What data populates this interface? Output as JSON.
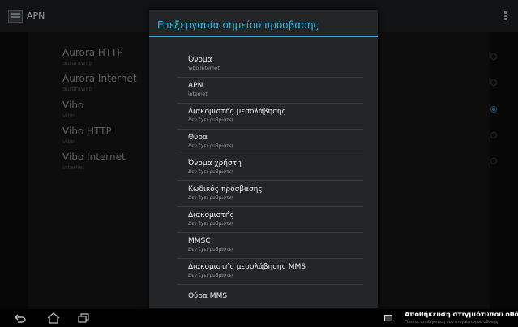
{
  "action_bar": {
    "title": "APN"
  },
  "apn_list": [
    {
      "name": "Aurora HTTP",
      "sub": "aurorawap",
      "selected": false
    },
    {
      "name": "Aurora Internet",
      "sub": "auroraweb",
      "selected": false
    },
    {
      "name": "Vibo",
      "sub": "vibo",
      "selected": true
    },
    {
      "name": "Vibo HTTP",
      "sub": "vibo",
      "selected": false
    },
    {
      "name": "Vibo Internet",
      "sub": "internet",
      "selected": false
    }
  ],
  "dialog": {
    "title": "Επεξεργασία σημείου πρόσβασης",
    "prefs": [
      {
        "title": "Όνομα",
        "sub": "Vibo Internet"
      },
      {
        "title": "APN",
        "sub": "internet"
      },
      {
        "title": "Διακομιστής μεσολάβησης",
        "sub": "Δεν έχει ρυθμιστεί"
      },
      {
        "title": "Θύρα",
        "sub": "Δεν έχει ρυθμιστεί"
      },
      {
        "title": "Όνομα χρήστη",
        "sub": "Δεν έχει ρυθμιστεί"
      },
      {
        "title": "Κωδικός πρόσβασης",
        "sub": "Δεν έχει ρυθμιστεί"
      },
      {
        "title": "Διακομιστής",
        "sub": "Δεν έχει ρυθμιστεί"
      },
      {
        "title": "MMSC",
        "sub": "Δεν έχει ρυθμιστεί"
      },
      {
        "title": "Διακομιστής μεσολάβησης MMS",
        "sub": "Δεν έχει ρυθμιστεί"
      },
      {
        "title": "Θύρα MMS",
        "sub": ""
      }
    ]
  },
  "notification": {
    "title": "Αποθήκευση στιγμιότυπου οθόνης...",
    "sub": "Γίνεται αποθήκευση του στιγμιότυπου οθόνης"
  },
  "icons": {
    "app": "apn-settings-icon",
    "overflow": "overflow-menu-icon",
    "back": "back-icon",
    "home": "home-icon",
    "recent": "recent-apps-icon",
    "notification": "screenshot-icon"
  },
  "colors": {
    "accent": "#33b5e5",
    "dialog_bg": "#232526"
  }
}
